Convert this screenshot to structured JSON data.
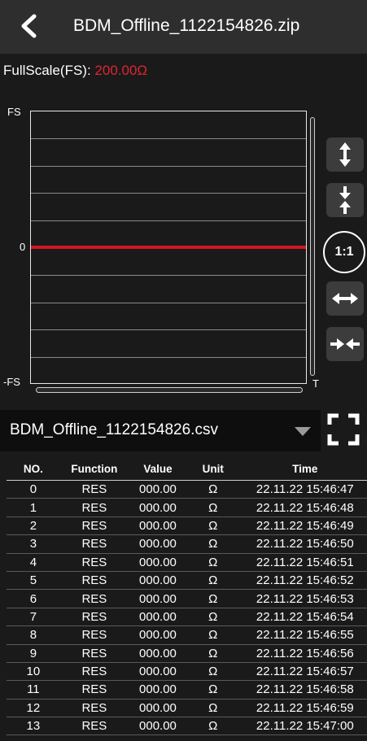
{
  "header": {
    "title": "BDM_Offline_1122154826.zip",
    "back_icon": "chevron-left-icon"
  },
  "fullscale": {
    "label": "FullScale(FS):",
    "value": "200.00Ω",
    "value_color": "#e0242f"
  },
  "chart": {
    "y_top_label": "FS",
    "y_zero_label": "0",
    "y_bottom_label": "-FS",
    "x_label": "T",
    "trace_color": "#d41620"
  },
  "chart_data": {
    "type": "line",
    "title": "",
    "xlabel": "T",
    "ylabel": "",
    "yticks": [
      "FS",
      "0",
      "-FS"
    ],
    "grid": true,
    "series": [
      {
        "values": [
          0,
          0,
          0,
          0,
          0,
          0,
          0,
          0,
          0,
          0,
          0,
          0,
          0,
          0
        ]
      }
    ]
  },
  "controls": {
    "one_to_one_label": "1:1",
    "icons": [
      "expand-vertical-icon",
      "compress-vertical-icon",
      "expand-horizontal-icon",
      "compress-horizontal-icon"
    ]
  },
  "file": {
    "name": "BDM_Offline_1122154826.csv",
    "dropdown_icon": "caret-down-icon",
    "fullscreen_icon": "fullscreen-icon"
  },
  "table": {
    "headers": [
      "NO.",
      "Function",
      "Value",
      "Unit",
      "Time"
    ],
    "rows": [
      [
        "0",
        "RES",
        "000.00",
        "Ω",
        "22.11.22 15:46:47"
      ],
      [
        "1",
        "RES",
        "000.00",
        "Ω",
        "22.11.22 15:46:48"
      ],
      [
        "2",
        "RES",
        "000.00",
        "Ω",
        "22.11.22 15:46:49"
      ],
      [
        "3",
        "RES",
        "000.00",
        "Ω",
        "22.11.22 15:46:50"
      ],
      [
        "4",
        "RES",
        "000.00",
        "Ω",
        "22.11.22 15:46:51"
      ],
      [
        "5",
        "RES",
        "000.00",
        "Ω",
        "22.11.22 15:46:52"
      ],
      [
        "6",
        "RES",
        "000.00",
        "Ω",
        "22.11.22 15:46:53"
      ],
      [
        "7",
        "RES",
        "000.00",
        "Ω",
        "22.11.22 15:46:54"
      ],
      [
        "8",
        "RES",
        "000.00",
        "Ω",
        "22.11.22 15:46:55"
      ],
      [
        "9",
        "RES",
        "000.00",
        "Ω",
        "22.11.22 15:46:56"
      ],
      [
        "10",
        "RES",
        "000.00",
        "Ω",
        "22.11.22 15:46:57"
      ],
      [
        "11",
        "RES",
        "000.00",
        "Ω",
        "22.11.22 15:46:58"
      ],
      [
        "12",
        "RES",
        "000.00",
        "Ω",
        "22.11.22 15:46:59"
      ],
      [
        "13",
        "RES",
        "000.00",
        "Ω",
        "22.11.22 15:47:00"
      ]
    ]
  }
}
